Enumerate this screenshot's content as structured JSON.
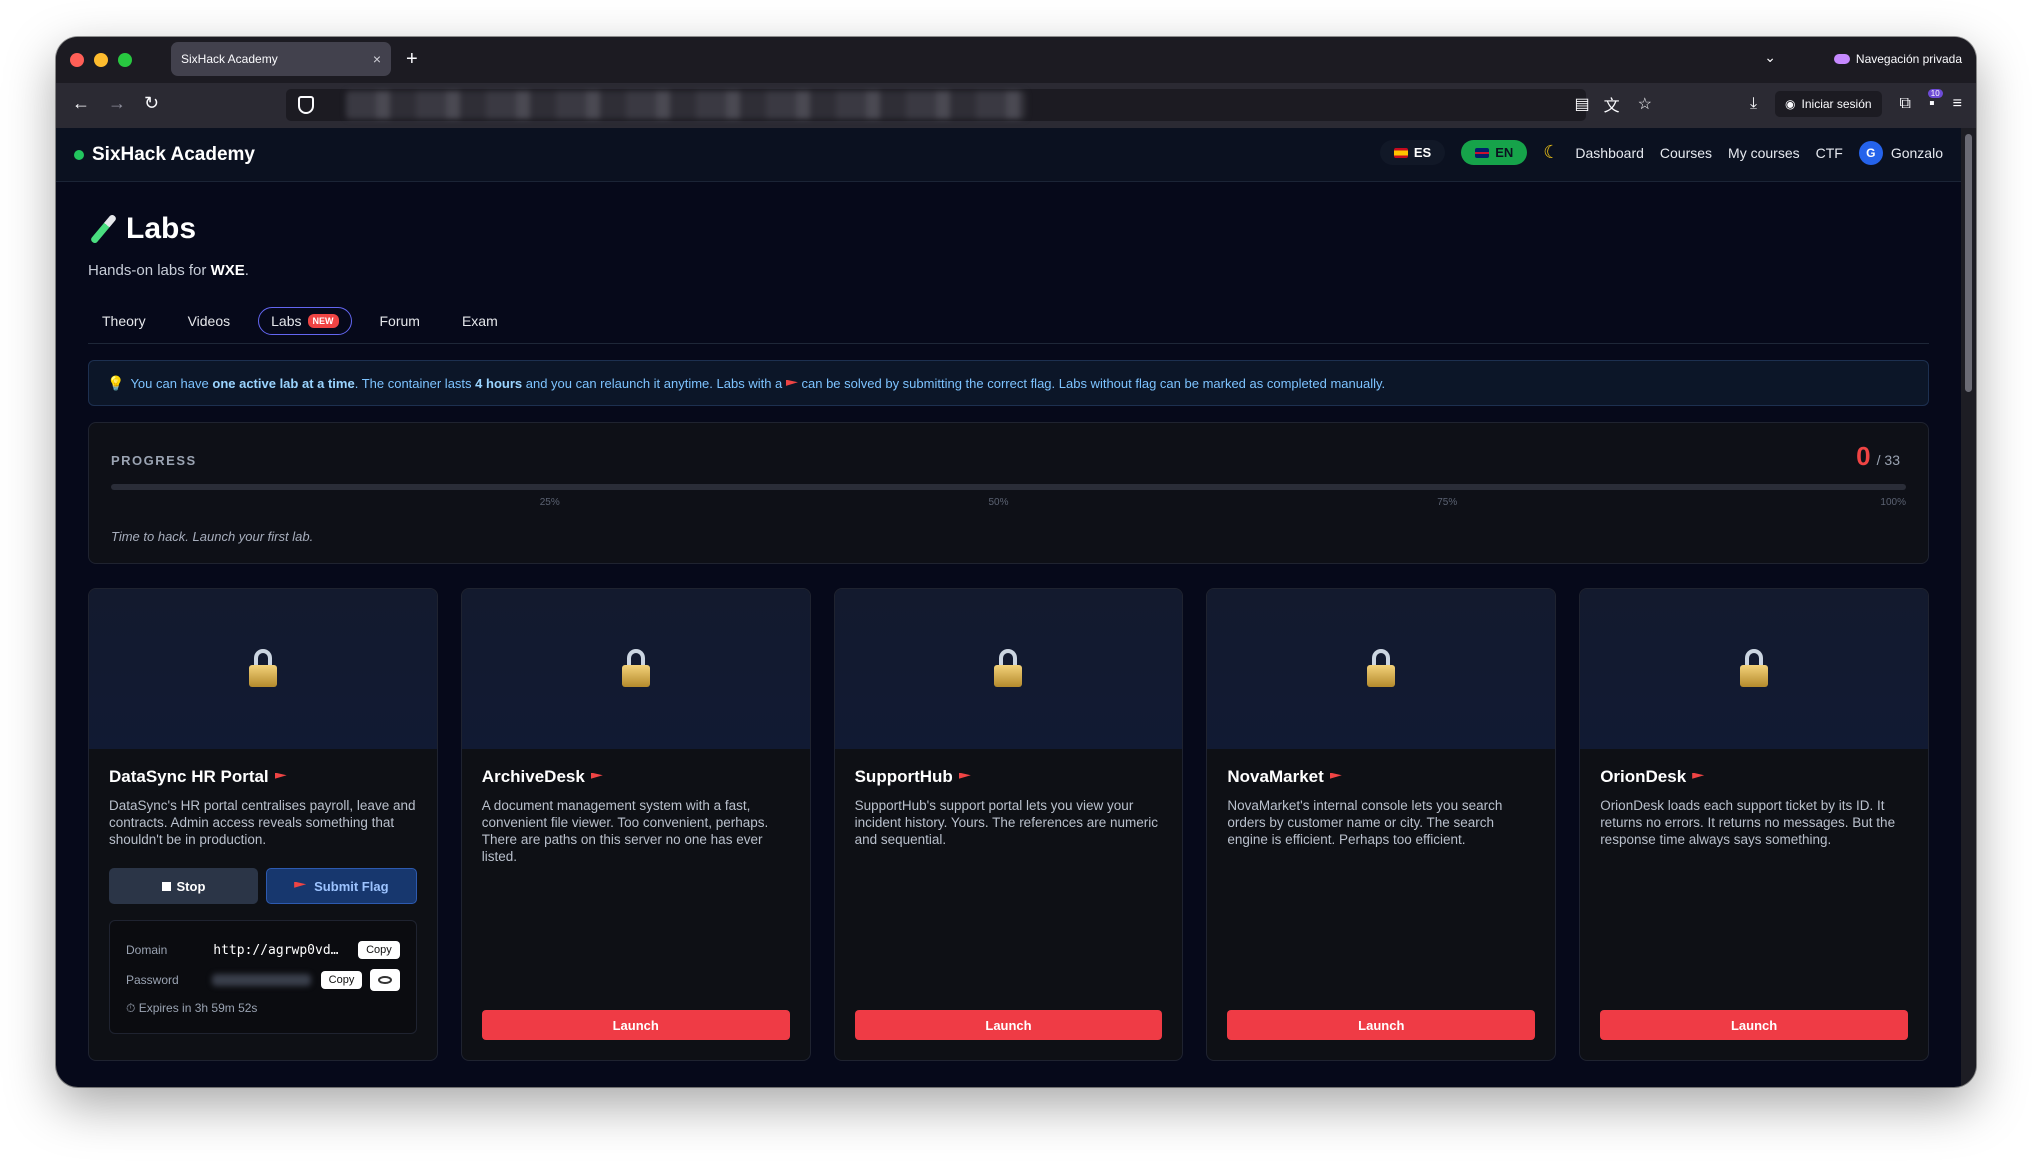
{
  "browser": {
    "tab_title": "SixHack Academy",
    "tab_close": "×",
    "new_tab": "+",
    "tab_list": "⌄",
    "private_label": "Navegación privada",
    "signin_label": "Iniciar sesión",
    "extensions_badge": "10"
  },
  "header": {
    "logo": "SixHack Academy",
    "lang_es": "ES",
    "lang_en": "EN",
    "nav": [
      "Dashboard",
      "Courses",
      "My courses",
      "CTF"
    ],
    "avatar_initial": "G",
    "username": "Gonzalo"
  },
  "page": {
    "title": "Labs",
    "subtitle_prefix": "Hands-on labs for ",
    "subtitle_course": "WXE",
    "subtitle_suffix": ".",
    "tabs": [
      "Theory",
      "Videos",
      "Labs",
      "Forum",
      "Exam"
    ],
    "new_badge": "NEW"
  },
  "info": {
    "part1": "You can have ",
    "bold1": "one active lab at a time",
    "part2": ". The container lasts ",
    "bold2": "4 hours",
    "part3": " and you can relaunch it anytime. Labs with a ",
    "part4": " can be solved by submitting the correct flag. Labs without flag can be marked as completed manually."
  },
  "progress": {
    "label": "PROGRESS",
    "completed": "0",
    "total": "/ 33",
    "fraction": 0,
    "ticks": [
      "25%",
      "50%",
      "75%",
      "100%"
    ],
    "message": "Time to hack. Launch your first lab."
  },
  "labs": [
    {
      "title": "DataSync HR Portal",
      "description": "DataSync's HR portal centralises payroll, leave and contracts. Admin access reveals something that shouldn't be in production.",
      "stop_label": "Stop",
      "submit_label": "Submit Flag",
      "domain_label": "Domain",
      "domain_value": "http://agrwp0vd…",
      "password_label": "Password",
      "copy_label": "Copy",
      "expires": "⏱ Expires in 3h 59m 52s"
    },
    {
      "title": "ArchiveDesk",
      "description": "A document management system with a fast, convenient file viewer. Too convenient, perhaps. There are paths on this server no one has ever listed.",
      "launch_label": "Launch"
    },
    {
      "title": "SupportHub",
      "description": "SupportHub's support portal lets you view your incident history. Yours. The references are numeric and sequential.",
      "launch_label": "Launch"
    },
    {
      "title": "NovaMarket",
      "description": "NovaMarket's internal console lets you search orders by customer name or city. The search engine is efficient. Perhaps too efficient.",
      "launch_label": "Launch"
    },
    {
      "title": "OrionDesk",
      "description": "OrionDesk loads each support ticket by its ID. It returns no errors. It returns no messages. But the response time always says something.",
      "launch_label": "Launch"
    }
  ],
  "colors": {
    "accent_red": "#ef4444",
    "accent_green": "#22c55e",
    "background": "#06091a"
  }
}
